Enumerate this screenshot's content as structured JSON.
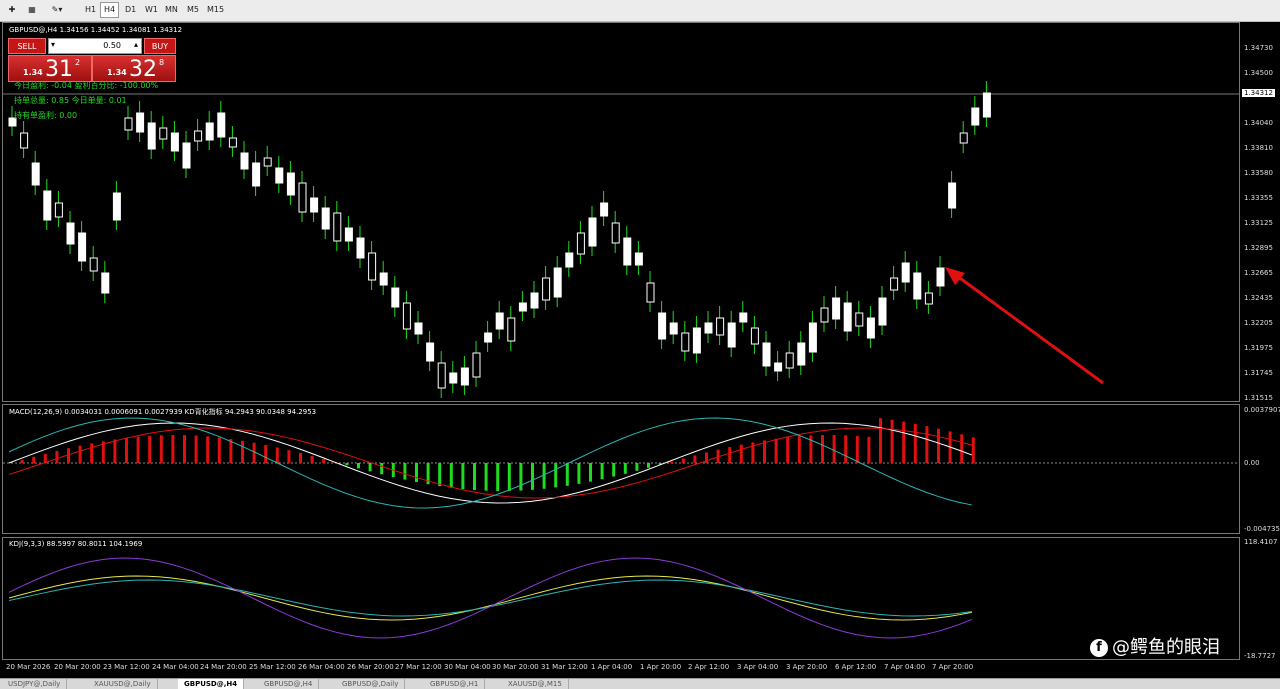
{
  "toolbar": {
    "timeframes": [
      "H1",
      "H4",
      "D1",
      "W1",
      "MN",
      "M5",
      "M15"
    ],
    "active_timeframe": "H4"
  },
  "main_chart": {
    "title": "GBPUSD@,H4  1.34156 1.34452 1.34081 1.34312",
    "current_price": "1.34312",
    "price_labels": [
      "1.34730",
      "1.34500",
      "1.34040",
      "1.33810",
      "1.33580",
      "1.33355",
      "1.33125",
      "1.32895",
      "1.32665",
      "1.32435",
      "1.32205",
      "1.31975",
      "1.31745",
      "1.31515"
    ]
  },
  "trade_panel": {
    "sell_label": "SELL",
    "buy_label": "BUY",
    "lot_value": "0.50",
    "sell_price_small": "1.34",
    "sell_price_big": "31",
    "sell_price_sup": "2",
    "buy_price_small": "1.34",
    "buy_price_big": "32",
    "buy_price_sup": "8"
  },
  "stats": {
    "line1": "今日盈利: -0.04   盈利百分比: -100.00%",
    "line2": "持单总量: 0.85   今日单量: 0.01",
    "line3": "持有单盈利: 0.00"
  },
  "macd_panel": {
    "title": "MACD(12,26,9) 0.0034031 0.0006091 0.0027939  KD背化指标 94.2943 90.0348 94.2953",
    "labels": [
      "0.0037907",
      "0.00",
      "-0.004735"
    ]
  },
  "kdj_panel": {
    "title": "KDJ(9,3,3) 88.5997 80.8011 104.1969",
    "labels": [
      "118.4107",
      "-18.7727"
    ]
  },
  "x_axis_labels": [
    "20 Mar 2026",
    "20 Mar 20:00",
    "23 Mar 12:00",
    "24 Mar 04:00",
    "24 Mar 20:00",
    "25 Mar 12:00",
    "26 Mar 04:00",
    "26 Mar 20:00",
    "27 Mar 12:00",
    "30 Mar 04:00",
    "30 Mar 20:00",
    "31 Mar 12:00",
    "1 Apr 04:00",
    "1 Apr 20:00",
    "2 Apr 12:00",
    "3 Apr 04:00",
    "3 Apr 20:00",
    "6 Apr 12:00",
    "7 Apr 04:00",
    "7 Apr 20:00"
  ],
  "tabs": [
    "USDJPY@,Daily",
    "XAUUSD@,Daily",
    "GBPUSD@,H4",
    "GBPUSD@,H4",
    "GBPUSD@,Daily",
    "GBPUSD@,H1",
    "XAUUSD@,M15"
  ],
  "active_tab_index": 2,
  "watermark": "@鳄鱼的眼泪",
  "colors": {
    "bull": "#ffffff",
    "bear": "#ffffff",
    "wick": "#1fdc1f",
    "arrow": "#e01010",
    "macd_pos": "#e01010",
    "macd_neg": "#1fdc1f"
  }
}
